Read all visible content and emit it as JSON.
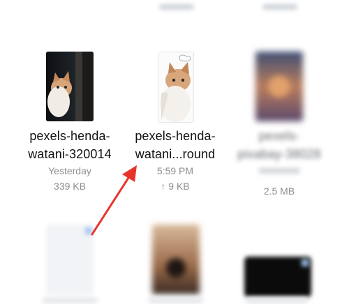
{
  "files": [
    {
      "name": "pexels-henda-watani-320014",
      "name_line1": "pexels-henda-",
      "name_line2": "watani-320014",
      "date": "Yesterday",
      "size": "339 KB",
      "blurred": false
    },
    {
      "name": "pexels-henda-watani...round",
      "name_line1": "pexels-henda-",
      "name_line2": "watani...round",
      "time": "5:59 PM",
      "upload_icon": "↑",
      "size": "9 KB",
      "blurred": false
    },
    {
      "name_line1": "pexels-",
      "name_line2": "pixabay-38028",
      "size": "2.5 MB",
      "blurred": true
    }
  ],
  "icons": {
    "upload": "arrow-up-icon"
  },
  "colors": {
    "arrow": "#e8332b",
    "secondary_text": "#8e8e93",
    "primary_text": "#111111"
  }
}
